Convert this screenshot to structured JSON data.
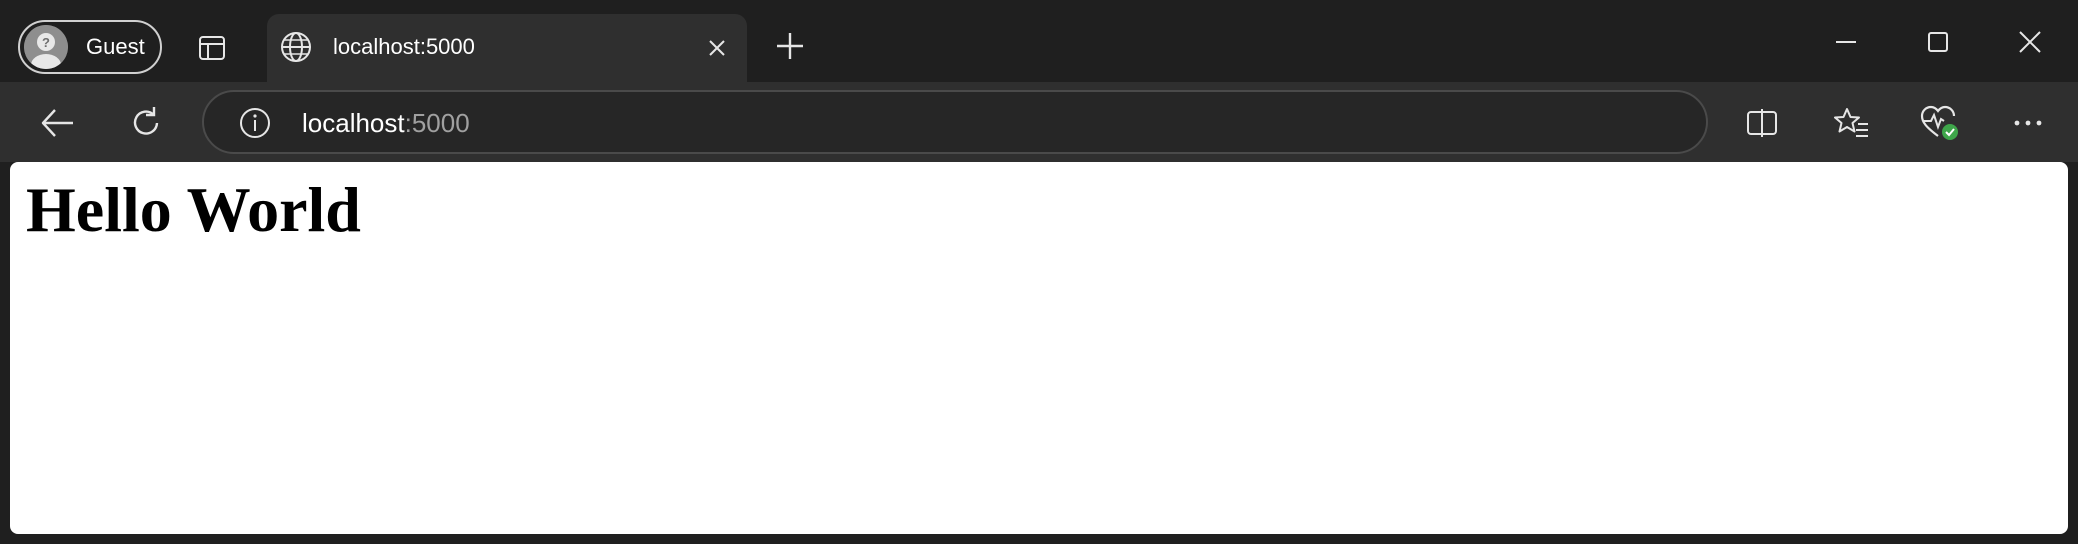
{
  "profile": {
    "label": "Guest"
  },
  "tab": {
    "title": "localhost:5000"
  },
  "address": {
    "host": "localhost",
    "port": ":5000"
  },
  "page": {
    "heading": "Hello World"
  },
  "colors": {
    "titlebar": "#1f1f1f",
    "toolbar": "#2f2f2f",
    "address_bg": "#262626",
    "icon": "#e6e6e6",
    "health_badge": "#3ea64a",
    "page_bg": "#ffffff"
  },
  "icons": {
    "profile": "person-avatar-icon",
    "tab_actions": "tab-actions-icon",
    "favicon": "globe-icon",
    "tab_close": "close-icon",
    "new_tab": "plus-icon",
    "minimize": "minimize-icon",
    "maximize": "maximize-icon",
    "close_window": "close-icon",
    "back": "back-arrow-icon",
    "refresh": "refresh-icon",
    "site_info": "info-icon",
    "split_screen": "split-screen-icon",
    "favorites": "favorites-star-icon",
    "browser_essentials": "heart-pulse-icon",
    "more": "more-dots-icon"
  }
}
